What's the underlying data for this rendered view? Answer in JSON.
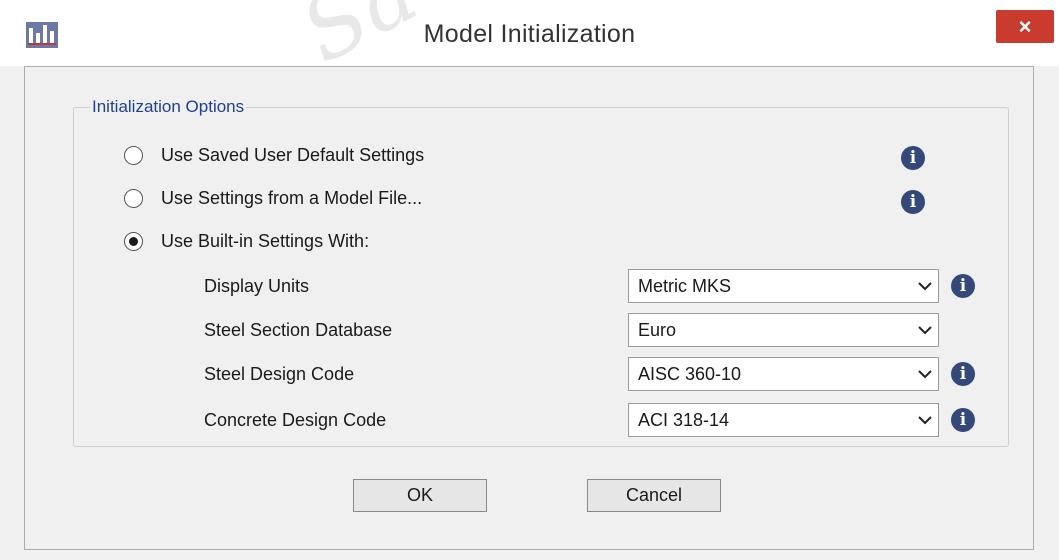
{
  "window": {
    "title": "Model Initialization",
    "watermark_text": "Sa",
    "close_label": "×"
  },
  "group": {
    "legend": "Initialization Options"
  },
  "options": [
    {
      "label": "Use Saved User Default Settings",
      "checked": false
    },
    {
      "label": "Use Settings from a Model File...",
      "checked": false
    },
    {
      "label": "Use Built-in Settings With:",
      "checked": true
    }
  ],
  "fields": [
    {
      "label": "Display Units",
      "value": "Metric MKS",
      "info": true
    },
    {
      "label": "Steel Section Database",
      "value": "Euro",
      "info": false
    },
    {
      "label": "Steel Design Code",
      "value": "AISC 360-10",
      "info": true
    },
    {
      "label": "Concrete Design Code",
      "value": "ACI 318-14",
      "info": true
    }
  ],
  "buttons": {
    "ok": "OK",
    "cancel": "Cancel"
  },
  "icons": {
    "info": "info-icon",
    "close": "close-icon",
    "dropdown": "chevron-down-icon",
    "app": "app-icon"
  },
  "colors": {
    "close_button": "#c83b2e",
    "legend_text": "#1e3f9a",
    "info_icon": "#34487a"
  }
}
